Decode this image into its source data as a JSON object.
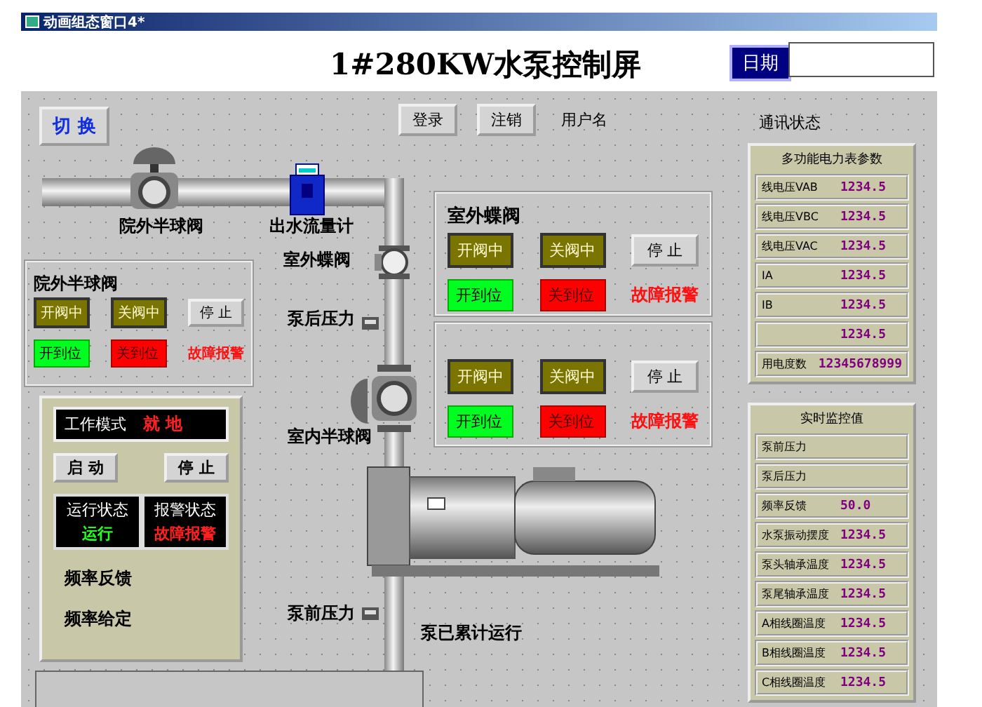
{
  "window": {
    "title": "动画组态窗口4*"
  },
  "header": {
    "title": "1#280KW水泵控制屏",
    "date_label": "日期"
  },
  "toolbar": {
    "switch_button": "切 换",
    "buttons": [
      "登录",
      "注销"
    ],
    "user_label": "用户名",
    "comm_label": "通讯状态"
  },
  "diagram_labels": [
    "院外半球阀",
    "出水流量计",
    "室外蝶阀",
    "泵后压力",
    "室内半球阀",
    "泵前压力",
    "泵已累计运行"
  ],
  "valve_panels": [
    {
      "title": "院外半球阀",
      "opening": "开阀中",
      "closing": "关阀中",
      "stop": "停 止",
      "open_limit": "开到位",
      "close_limit": "关到位",
      "fault": "故障报警"
    },
    {
      "title": "室外蝶阀",
      "opening": "开阀中",
      "closing": "关阀中",
      "stop": "停 止",
      "open_limit": "开到位",
      "close_limit": "关到位",
      "fault": "故障报警"
    },
    {
      "opening": "开阀中",
      "closing": "关阀中",
      "stop": "停 止",
      "open_limit": "开到位",
      "close_limit": "关到位",
      "fault": "故障报警"
    }
  ],
  "control_panel": {
    "mode_label": "工作模式",
    "mode_value": "就 地",
    "start": "启 动",
    "stop": "停 止",
    "run_label": "运行状态",
    "run_value": "运行",
    "alarm_label": "报警状态",
    "alarm_value": "故障报警",
    "freq_feedback": "频率反馈",
    "freq_setpoint": "频率给定"
  },
  "meter_panel": {
    "title": "多功能电力表参数",
    "rows": [
      {
        "label": "线电压VAB",
        "value": "1234.5"
      },
      {
        "label": "线电压VBC",
        "value": "1234.5"
      },
      {
        "label": "线电压VAC",
        "value": "1234.5"
      },
      {
        "label": "IA",
        "value": "1234.5"
      },
      {
        "label": "IB",
        "value": "1234.5"
      },
      {
        "value": "1234.5"
      },
      {
        "label": "用电度数",
        "value": "12345678999"
      }
    ]
  },
  "monitor_panel": {
    "title": "实时监控值",
    "rows": [
      {
        "label": "泵前压力"
      },
      {
        "label": "泵后压力"
      },
      {
        "label": "频率反馈",
        "value": "50.0"
      },
      {
        "label": "水泵振动摆度",
        "value": "1234.5"
      },
      {
        "label": "泵头轴承温度",
        "value": "1234.5"
      },
      {
        "label": "泵尾轴承温度",
        "value": "1234.5"
      },
      {
        "label": "A相线圈温度",
        "value": "1234.5"
      },
      {
        "label": "B相线圈温度",
        "value": "1234.5"
      },
      {
        "label": "C相线圈温度",
        "value": "1234.5"
      }
    ]
  }
}
